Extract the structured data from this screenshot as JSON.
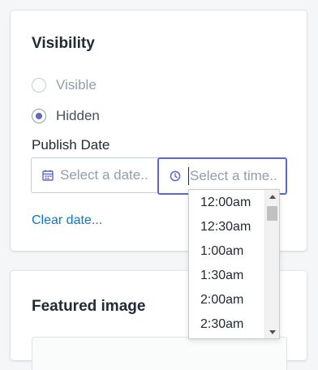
{
  "visibility_card": {
    "title": "Visibility",
    "options": [
      {
        "label": "Visible",
        "checked": false
      },
      {
        "label": "Hidden",
        "checked": true
      }
    ],
    "publish_date_label": "Publish Date",
    "date_input": {
      "placeholder": "Select a date..",
      "icon": "calendar-icon"
    },
    "time_input": {
      "placeholder": "Select a time..",
      "icon": "clock-icon"
    },
    "clear_link": "Clear date..."
  },
  "time_dropdown": {
    "items": [
      "12:00am",
      "12:30am",
      "1:00am",
      "1:30am",
      "2:00am",
      "2:30am"
    ]
  },
  "featured_card": {
    "title": "Featured image"
  },
  "colors": {
    "accent": "#5c6ac4",
    "link": "#007ace",
    "text": "#212b36",
    "muted": "#919eab"
  }
}
